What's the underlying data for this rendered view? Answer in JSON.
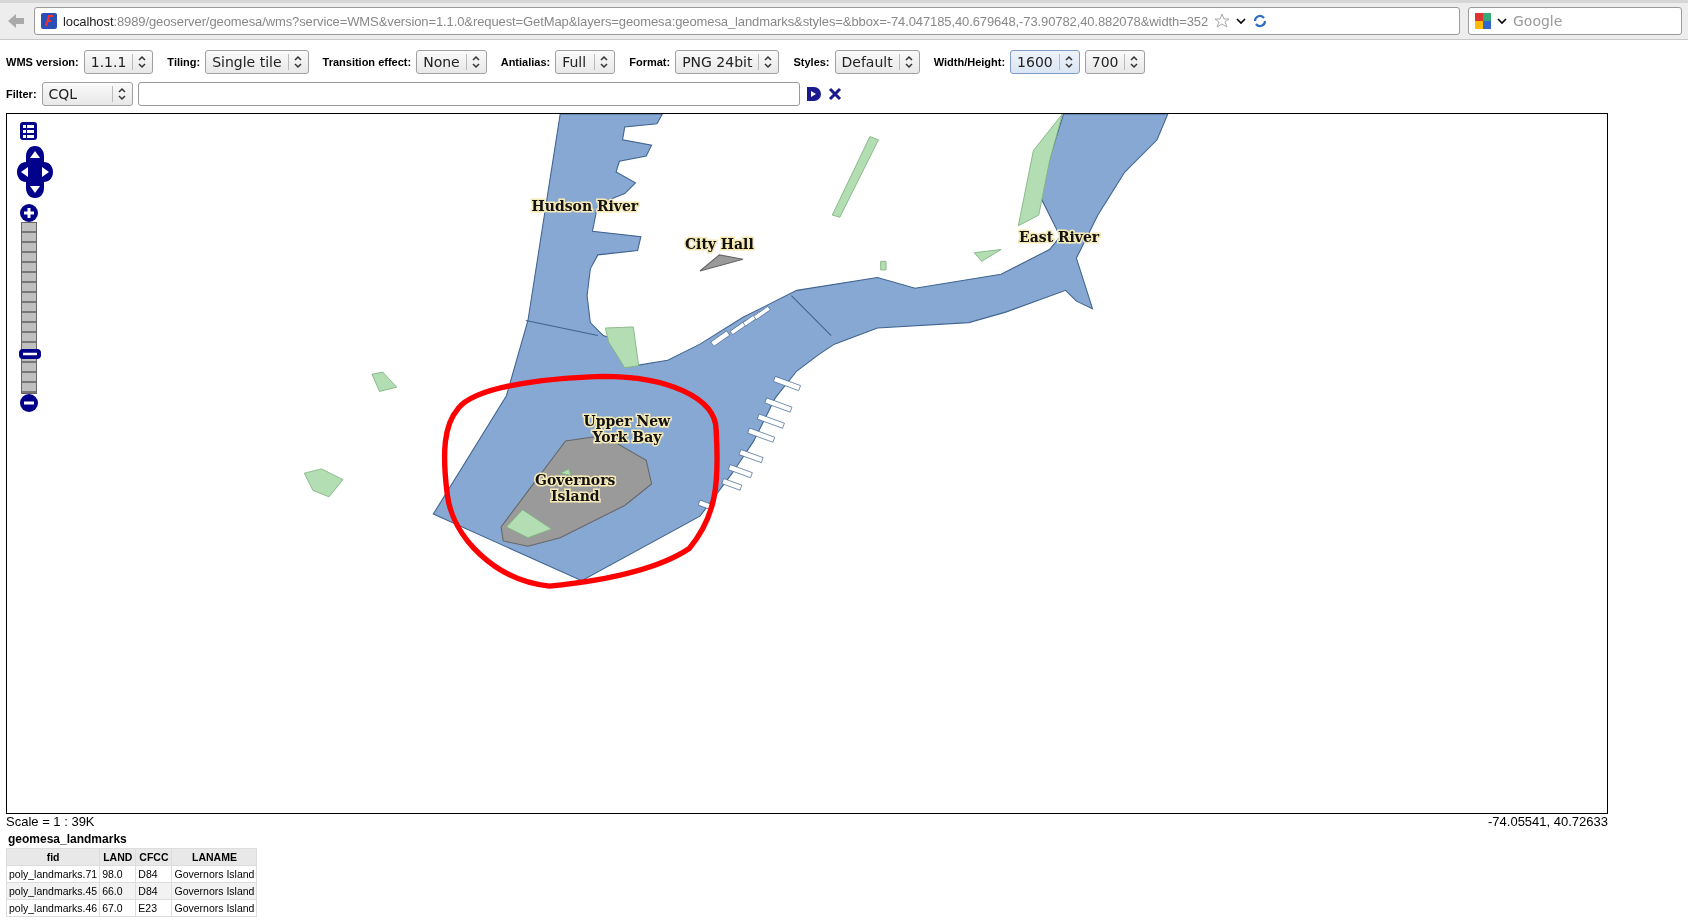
{
  "browser": {
    "url_host": "localhost",
    "url_rest": ":8989/geoserver/geomesa/wms?service=WMS&version=1.1.0&request=GetMap&layers=geomesa:geomesa_landmarks&styles=&bbox=-74.047185,40.679648,-73.90782,40.882078&width=352",
    "search_placeholder": "Google"
  },
  "toolbar": [
    {
      "label": "WMS version:",
      "selects": [
        {
          "value": "1.1.1",
          "focused": false
        }
      ]
    },
    {
      "label": "Tiling:",
      "selects": [
        {
          "value": "Single tile",
          "focused": false
        }
      ]
    },
    {
      "label": "Transition effect:",
      "selects": [
        {
          "value": "None",
          "focused": false
        }
      ]
    },
    {
      "label": "Antialias:",
      "selects": [
        {
          "value": "Full",
          "focused": false
        }
      ]
    },
    {
      "label": "Format:",
      "selects": [
        {
          "value": "PNG 24bit",
          "focused": false
        }
      ]
    },
    {
      "label": "Styles:",
      "selects": [
        {
          "value": "Default",
          "focused": false
        }
      ]
    },
    {
      "label": "Width/Height:",
      "selects": [
        {
          "value": "1600",
          "focused": true
        },
        {
          "value": "700",
          "focused": false
        }
      ]
    }
  ],
  "filter": {
    "label": "Filter:",
    "select": "CQL"
  },
  "map": {
    "zoom_slider": {
      "level": 0.23
    },
    "labels": [
      {
        "lines": [
          "Hudson River"
        ]
      },
      {
        "lines": [
          "City Hall"
        ]
      },
      {
        "lines": [
          "East River"
        ]
      },
      {
        "lines": [
          "Upper New",
          "York Bay"
        ]
      },
      {
        "lines": [
          "Governors",
          "Island"
        ]
      }
    ]
  },
  "scale": "Scale = 1 : 39K",
  "coordinates": "-74.05541, 40.72633",
  "layer_title": "geomesa_landmarks",
  "table": {
    "columns": [
      "fid",
      "LAND",
      "CFCC",
      "LANAME"
    ],
    "rows": [
      [
        "poly_landmarks.71",
        "98.0",
        "D84",
        "Governors Island"
      ],
      [
        "poly_landmarks.45",
        "66.0",
        "D84",
        "Governors Island"
      ],
      [
        "poly_landmarks.46",
        "67.0",
        "E23",
        "Governors Island"
      ]
    ]
  }
}
